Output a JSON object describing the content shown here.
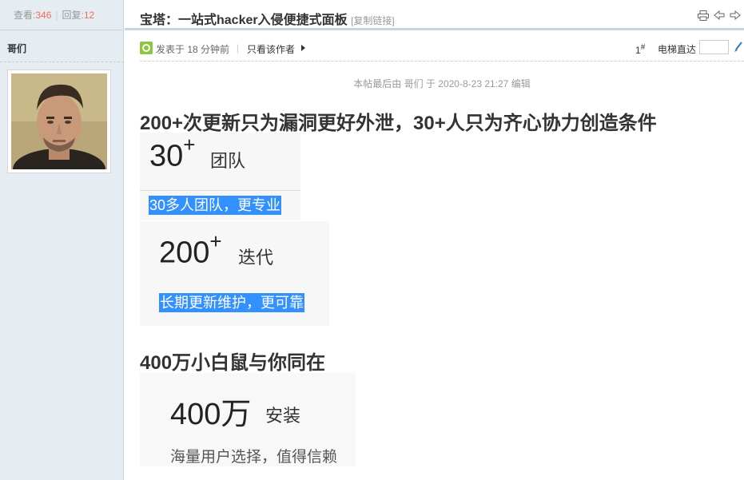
{
  "sidebar": {
    "views_label": "查看:",
    "views_count": "346",
    "replies_label": "回复:",
    "replies_count": "12",
    "author_name": "哥们"
  },
  "header": {
    "title": "宝塔：一站式hacker入侵便捷式面板",
    "copy_link": "[复制链接]",
    "icons": [
      "print-icon",
      "prev-thread-icon",
      "next-thread-icon"
    ]
  },
  "meta": {
    "post_time": "发表于 18 分钟前",
    "separator": "|",
    "only_author": "只看该作者",
    "floor": "1",
    "floor_suffix": "#",
    "jump_label": "电梯直达",
    "jump_value": ""
  },
  "post": {
    "last_edit": "本帖最后由 哥们 于 2020-8-23 21:27 编辑",
    "headline_1": "200+次更新只为漏洞更好外泄，30+人只为齐心协力创造条件",
    "card_1": {
      "number": "30",
      "sup": "+",
      "unit": "团队",
      "sub": "30多人团队，更专业"
    },
    "card_2": {
      "number": "200",
      "sup": "+",
      "unit": "迭代",
      "sub": "长期更新维护，更可靠"
    },
    "headline_2": "400万小白鼠与你同在",
    "card_3": {
      "number": "400万",
      "unit": "安装",
      "sub": "海量用户选择，值得信赖"
    }
  },
  "colors": {
    "sidebar_bg": "#e5edf2",
    "border": "#c2d5e3",
    "count_color": "#f26c4f",
    "selection": "#3390ff"
  }
}
